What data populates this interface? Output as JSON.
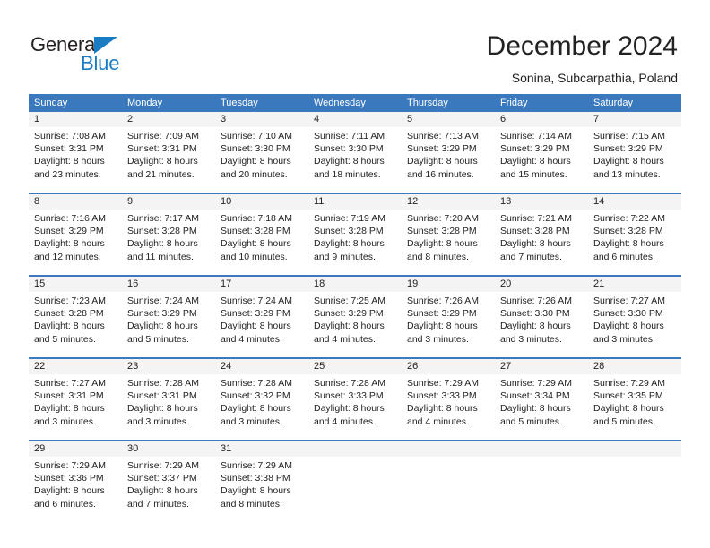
{
  "brand": {
    "name_top": "General",
    "name_bottom": "Blue",
    "triangle_color": "#1a7dc4",
    "text_color": "#231f20"
  },
  "header": {
    "title": "December 2024",
    "location": "Sonina, Subcarpathia, Poland",
    "header_bg": "#3a79bd",
    "header_text": "#ffffff",
    "daynum_bg": "#f4f4f4"
  },
  "weekdays": [
    "Sunday",
    "Monday",
    "Tuesday",
    "Wednesday",
    "Thursday",
    "Friday",
    "Saturday"
  ],
  "weeks": [
    [
      {
        "day": "1",
        "sunrise": "Sunrise: 7:08 AM",
        "sunset": "Sunset: 3:31 PM",
        "daylight1": "Daylight: 8 hours",
        "daylight2": "and 23 minutes."
      },
      {
        "day": "2",
        "sunrise": "Sunrise: 7:09 AM",
        "sunset": "Sunset: 3:31 PM",
        "daylight1": "Daylight: 8 hours",
        "daylight2": "and 21 minutes."
      },
      {
        "day": "3",
        "sunrise": "Sunrise: 7:10 AM",
        "sunset": "Sunset: 3:30 PM",
        "daylight1": "Daylight: 8 hours",
        "daylight2": "and 20 minutes."
      },
      {
        "day": "4",
        "sunrise": "Sunrise: 7:11 AM",
        "sunset": "Sunset: 3:30 PM",
        "daylight1": "Daylight: 8 hours",
        "daylight2": "and 18 minutes."
      },
      {
        "day": "5",
        "sunrise": "Sunrise: 7:13 AM",
        "sunset": "Sunset: 3:29 PM",
        "daylight1": "Daylight: 8 hours",
        "daylight2": "and 16 minutes."
      },
      {
        "day": "6",
        "sunrise": "Sunrise: 7:14 AM",
        "sunset": "Sunset: 3:29 PM",
        "daylight1": "Daylight: 8 hours",
        "daylight2": "and 15 minutes."
      },
      {
        "day": "7",
        "sunrise": "Sunrise: 7:15 AM",
        "sunset": "Sunset: 3:29 PM",
        "daylight1": "Daylight: 8 hours",
        "daylight2": "and 13 minutes."
      }
    ],
    [
      {
        "day": "8",
        "sunrise": "Sunrise: 7:16 AM",
        "sunset": "Sunset: 3:29 PM",
        "daylight1": "Daylight: 8 hours",
        "daylight2": "and 12 minutes."
      },
      {
        "day": "9",
        "sunrise": "Sunrise: 7:17 AM",
        "sunset": "Sunset: 3:28 PM",
        "daylight1": "Daylight: 8 hours",
        "daylight2": "and 11 minutes."
      },
      {
        "day": "10",
        "sunrise": "Sunrise: 7:18 AM",
        "sunset": "Sunset: 3:28 PM",
        "daylight1": "Daylight: 8 hours",
        "daylight2": "and 10 minutes."
      },
      {
        "day": "11",
        "sunrise": "Sunrise: 7:19 AM",
        "sunset": "Sunset: 3:28 PM",
        "daylight1": "Daylight: 8 hours",
        "daylight2": "and 9 minutes."
      },
      {
        "day": "12",
        "sunrise": "Sunrise: 7:20 AM",
        "sunset": "Sunset: 3:28 PM",
        "daylight1": "Daylight: 8 hours",
        "daylight2": "and 8 minutes."
      },
      {
        "day": "13",
        "sunrise": "Sunrise: 7:21 AM",
        "sunset": "Sunset: 3:28 PM",
        "daylight1": "Daylight: 8 hours",
        "daylight2": "and 7 minutes."
      },
      {
        "day": "14",
        "sunrise": "Sunrise: 7:22 AM",
        "sunset": "Sunset: 3:28 PM",
        "daylight1": "Daylight: 8 hours",
        "daylight2": "and 6 minutes."
      }
    ],
    [
      {
        "day": "15",
        "sunrise": "Sunrise: 7:23 AM",
        "sunset": "Sunset: 3:28 PM",
        "daylight1": "Daylight: 8 hours",
        "daylight2": "and 5 minutes."
      },
      {
        "day": "16",
        "sunrise": "Sunrise: 7:24 AM",
        "sunset": "Sunset: 3:29 PM",
        "daylight1": "Daylight: 8 hours",
        "daylight2": "and 5 minutes."
      },
      {
        "day": "17",
        "sunrise": "Sunrise: 7:24 AM",
        "sunset": "Sunset: 3:29 PM",
        "daylight1": "Daylight: 8 hours",
        "daylight2": "and 4 minutes."
      },
      {
        "day": "18",
        "sunrise": "Sunrise: 7:25 AM",
        "sunset": "Sunset: 3:29 PM",
        "daylight1": "Daylight: 8 hours",
        "daylight2": "and 4 minutes."
      },
      {
        "day": "19",
        "sunrise": "Sunrise: 7:26 AM",
        "sunset": "Sunset: 3:29 PM",
        "daylight1": "Daylight: 8 hours",
        "daylight2": "and 3 minutes."
      },
      {
        "day": "20",
        "sunrise": "Sunrise: 7:26 AM",
        "sunset": "Sunset: 3:30 PM",
        "daylight1": "Daylight: 8 hours",
        "daylight2": "and 3 minutes."
      },
      {
        "day": "21",
        "sunrise": "Sunrise: 7:27 AM",
        "sunset": "Sunset: 3:30 PM",
        "daylight1": "Daylight: 8 hours",
        "daylight2": "and 3 minutes."
      }
    ],
    [
      {
        "day": "22",
        "sunrise": "Sunrise: 7:27 AM",
        "sunset": "Sunset: 3:31 PM",
        "daylight1": "Daylight: 8 hours",
        "daylight2": "and 3 minutes."
      },
      {
        "day": "23",
        "sunrise": "Sunrise: 7:28 AM",
        "sunset": "Sunset: 3:31 PM",
        "daylight1": "Daylight: 8 hours",
        "daylight2": "and 3 minutes."
      },
      {
        "day": "24",
        "sunrise": "Sunrise: 7:28 AM",
        "sunset": "Sunset: 3:32 PM",
        "daylight1": "Daylight: 8 hours",
        "daylight2": "and 3 minutes."
      },
      {
        "day": "25",
        "sunrise": "Sunrise: 7:28 AM",
        "sunset": "Sunset: 3:33 PM",
        "daylight1": "Daylight: 8 hours",
        "daylight2": "and 4 minutes."
      },
      {
        "day": "26",
        "sunrise": "Sunrise: 7:29 AM",
        "sunset": "Sunset: 3:33 PM",
        "daylight1": "Daylight: 8 hours",
        "daylight2": "and 4 minutes."
      },
      {
        "day": "27",
        "sunrise": "Sunrise: 7:29 AM",
        "sunset": "Sunset: 3:34 PM",
        "daylight1": "Daylight: 8 hours",
        "daylight2": "and 5 minutes."
      },
      {
        "day": "28",
        "sunrise": "Sunrise: 7:29 AM",
        "sunset": "Sunset: 3:35 PM",
        "daylight1": "Daylight: 8 hours",
        "daylight2": "and 5 minutes."
      }
    ],
    [
      {
        "day": "29",
        "sunrise": "Sunrise: 7:29 AM",
        "sunset": "Sunset: 3:36 PM",
        "daylight1": "Daylight: 8 hours",
        "daylight2": "and 6 minutes."
      },
      {
        "day": "30",
        "sunrise": "Sunrise: 7:29 AM",
        "sunset": "Sunset: 3:37 PM",
        "daylight1": "Daylight: 8 hours",
        "daylight2": "and 7 minutes."
      },
      {
        "day": "31",
        "sunrise": "Sunrise: 7:29 AM",
        "sunset": "Sunset: 3:38 PM",
        "daylight1": "Daylight: 8 hours",
        "daylight2": "and 8 minutes."
      },
      {
        "day": "",
        "sunrise": "",
        "sunset": "",
        "daylight1": "",
        "daylight2": ""
      },
      {
        "day": "",
        "sunrise": "",
        "sunset": "",
        "daylight1": "",
        "daylight2": ""
      },
      {
        "day": "",
        "sunrise": "",
        "sunset": "",
        "daylight1": "",
        "daylight2": ""
      },
      {
        "day": "",
        "sunrise": "",
        "sunset": "",
        "daylight1": "",
        "daylight2": ""
      }
    ]
  ]
}
